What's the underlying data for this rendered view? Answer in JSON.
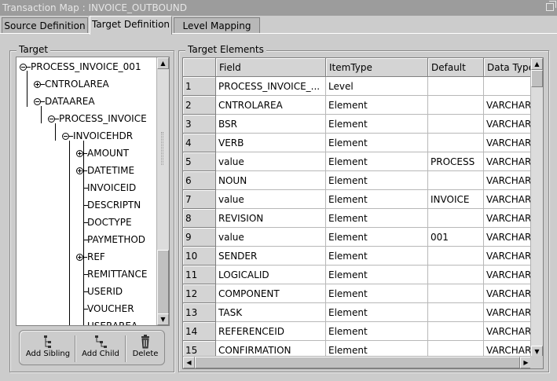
{
  "window": {
    "title": "Transaction Map : INVOICE_OUTBOUND"
  },
  "tabs": [
    {
      "label": "Source Definition",
      "active": false
    },
    {
      "label": "Target Definition",
      "active": true
    },
    {
      "label": "Level Mapping",
      "active": false
    }
  ],
  "target_panel": {
    "legend": "Target",
    "tree": [
      {
        "label": "PROCESS_INVOICE_001",
        "expander": "minus"
      },
      {
        "label": "CNTROLAREA",
        "expander": "plus"
      },
      {
        "label": "DATAAREA",
        "expander": "minus"
      },
      {
        "label": "PROCESS_INVOICE",
        "expander": "minus"
      },
      {
        "label": "INVOICEHDR",
        "expander": "minus"
      },
      {
        "label": "AMOUNT",
        "expander": "plus"
      },
      {
        "label": "DATETIME",
        "expander": "plus"
      },
      {
        "label": "INVOICEID",
        "expander": "none"
      },
      {
        "label": "DESCRIPTN",
        "expander": "none"
      },
      {
        "label": "DOCTYPE",
        "expander": "none"
      },
      {
        "label": "PAYMETHOD",
        "expander": "none"
      },
      {
        "label": "REF",
        "expander": "plus"
      },
      {
        "label": "REMITTANCE",
        "expander": "none"
      },
      {
        "label": "USERID",
        "expander": "none"
      },
      {
        "label": "VOUCHER",
        "expander": "none"
      },
      {
        "label": "USERAREA",
        "expander": "none"
      }
    ],
    "toolbar": {
      "add_sibling": "Add Sibling",
      "add_child": "Add Child",
      "delete": "Delete"
    }
  },
  "elements_panel": {
    "legend": "Target Elements",
    "columns": [
      "",
      "Field",
      "ItemType",
      "Default",
      "Data Type"
    ],
    "rows": [
      [
        "1",
        "PROCESS_INVOICE_...",
        "Level",
        "",
        ""
      ],
      [
        "2",
        "CNTROLAREA",
        "Element",
        "",
        "VARCHAR"
      ],
      [
        "3",
        "BSR",
        "Element",
        "",
        "VARCHAR"
      ],
      [
        "4",
        "VERB",
        "Element",
        "",
        "VARCHAR"
      ],
      [
        "5",
        "value",
        "Element",
        "PROCESS",
        "VARCHAR"
      ],
      [
        "6",
        "NOUN",
        "Element",
        "",
        "VARCHAR"
      ],
      [
        "7",
        "value",
        "Element",
        "INVOICE",
        "VARCHAR"
      ],
      [
        "8",
        "REVISION",
        "Element",
        "",
        "VARCHAR"
      ],
      [
        "9",
        "value",
        "Element",
        "001",
        "VARCHAR"
      ],
      [
        "10",
        "SENDER",
        "Element",
        "",
        "VARCHAR"
      ],
      [
        "11",
        "LOGICALID",
        "Element",
        "",
        "VARCHAR"
      ],
      [
        "12",
        "COMPONENT",
        "Element",
        "",
        "VARCHAR"
      ],
      [
        "13",
        "TASK",
        "Element",
        "",
        "VARCHAR"
      ],
      [
        "14",
        "REFERENCEID",
        "Element",
        "",
        "VARCHAR"
      ],
      [
        "15",
        "CONFIRMATION",
        "Element",
        "",
        "VARCHAR"
      ]
    ]
  }
}
